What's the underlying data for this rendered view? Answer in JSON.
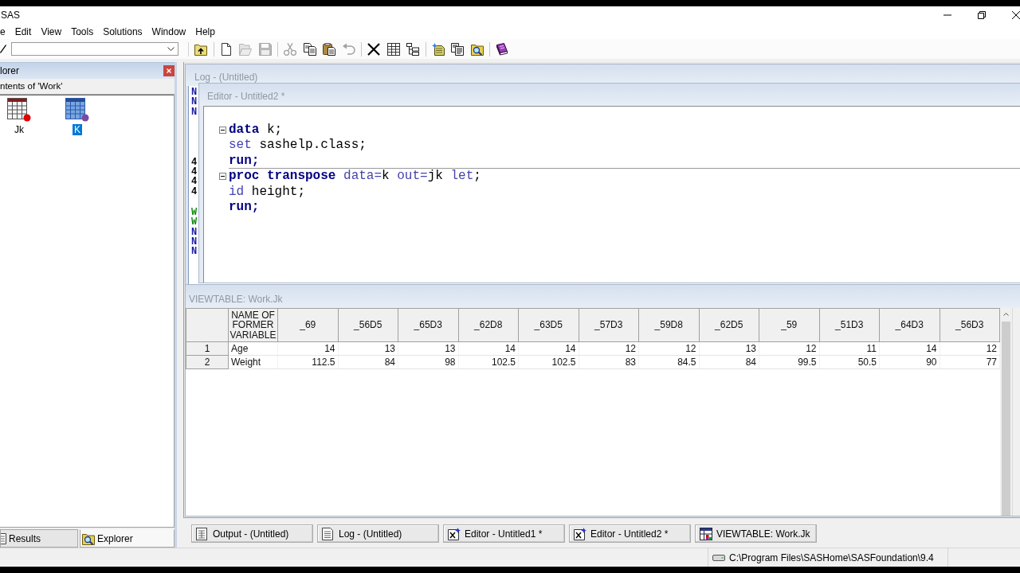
{
  "window": {
    "title": "SAS"
  },
  "menu": [
    "e",
    "Edit",
    "View",
    "Tools",
    "Solutions",
    "Window",
    "Help"
  ],
  "toolbar": [
    [
      {
        "kind": "up-folder",
        "disabled": false
      }
    ],
    [
      {
        "kind": "new",
        "disabled": false
      },
      {
        "kind": "open",
        "disabled": true
      },
      {
        "kind": "save",
        "disabled": true
      }
    ],
    [
      {
        "kind": "cut",
        "disabled": true
      },
      {
        "kind": "copy",
        "disabled": false
      },
      {
        "kind": "paste",
        "disabled": false
      },
      {
        "kind": "undo",
        "disabled": true
      }
    ],
    [
      {
        "kind": "delete",
        "disabled": false
      },
      {
        "kind": "details",
        "disabled": false
      },
      {
        "kind": "tree",
        "disabled": false
      }
    ],
    [
      {
        "kind": "new-library",
        "disabled": false
      },
      {
        "kind": "properties",
        "disabled": false
      },
      {
        "kind": "find",
        "disabled": false
      }
    ],
    [
      {
        "kind": "help",
        "disabled": false
      }
    ]
  ],
  "explorer": {
    "title": "lorer",
    "location": "ntents of 'Work'",
    "items": [
      {
        "name": "Jk",
        "selected": false
      },
      {
        "name": "K",
        "selected": true
      }
    ],
    "tabs": [
      {
        "label": "Results",
        "kind": "results",
        "selected": false
      },
      {
        "label": "Explorer",
        "kind": "explorer",
        "selected": true
      }
    ]
  },
  "log": {
    "title": "Log - (Untitled)",
    "blocks": [
      [
        {
          "text": "N",
          "kind": "note"
        },
        {
          "text": "N",
          "kind": "note"
        },
        {
          "text": "N",
          "kind": "note"
        }
      ],
      [
        {
          "text": "4",
          "kind": "source"
        },
        {
          "text": "4",
          "kind": "source"
        },
        {
          "text": "4",
          "kind": "source"
        },
        {
          "text": "4",
          "kind": "source"
        }
      ],
      [
        {
          "text": "W",
          "kind": "warning"
        },
        {
          "text": "W",
          "kind": "warning"
        },
        {
          "text": "N",
          "kind": "note"
        },
        {
          "text": "N",
          "kind": "note"
        },
        {
          "text": "N",
          "kind": "note"
        }
      ]
    ]
  },
  "editor": {
    "title": "Editor - Untitled2 *",
    "lines": [
      {
        "fold": true,
        "tokens": [
          {
            "text": "data",
            "kind": "step"
          },
          {
            "text": " k;",
            "kind": "plain"
          }
        ]
      },
      {
        "fold": false,
        "tokens": [
          {
            "text": "set",
            "kind": "keyword"
          },
          {
            "text": " sashelp.class;",
            "kind": "plain"
          }
        ]
      },
      {
        "fold": false,
        "tokens": [
          {
            "text": "run;",
            "kind": "step"
          }
        ]
      },
      {
        "fold": true,
        "tokens": [
          {
            "text": "proc transpose",
            "kind": "step"
          },
          {
            "text": " data=",
            "kind": "keyword"
          },
          {
            "text": "k ",
            "kind": "plain"
          },
          {
            "text": "out=",
            "kind": "keyword"
          },
          {
            "text": "jk ",
            "kind": "plain"
          },
          {
            "text": "let",
            "kind": "keyword"
          },
          {
            "text": ";",
            "kind": "plain"
          }
        ]
      },
      {
        "fold": false,
        "tokens": [
          {
            "text": "id",
            "kind": "keyword"
          },
          {
            "text": " height;",
            "kind": "plain"
          }
        ]
      },
      {
        "fold": false,
        "tokens": [
          {
            "text": "run;",
            "kind": "step"
          }
        ]
      }
    ]
  },
  "viewtable": {
    "title": "VIEWTABLE: Work.Jk",
    "columns": [
      "NAME OF FORMER VARIABLE",
      "_69",
      "_56D5",
      "_65D3",
      "_62D8",
      "_63D5",
      "_57D3",
      "_59D8",
      "_62D5",
      "_59",
      "_51D3",
      "_64D3",
      "_56D3"
    ],
    "rows": [
      {
        "number": "1",
        "cells": [
          "Age",
          "14",
          "13",
          "13",
          "14",
          "14",
          "12",
          "12",
          "13",
          "12",
          "11",
          "14",
          "12"
        ]
      },
      {
        "number": "2",
        "cells": [
          "Weight",
          "112.5",
          "84",
          "98",
          "102.5",
          "102.5",
          "83",
          "84.5",
          "84",
          "99.5",
          "50.5",
          "90",
          "77"
        ]
      }
    ]
  },
  "window_bar": [
    {
      "label": "Output - (Untitled)",
      "kind": "output"
    },
    {
      "label": "Log - (Untitled)",
      "kind": "log"
    },
    {
      "label": "Editor - Untitled1 *",
      "kind": "editor"
    },
    {
      "label": "Editor - Untitled2 *",
      "kind": "editor"
    },
    {
      "label": "VIEWTABLE: Work.Jk",
      "kind": "viewtable"
    }
  ],
  "status_bar": {
    "path": "C:\\Program Files\\SASHome\\SASFoundation\\9.4"
  }
}
